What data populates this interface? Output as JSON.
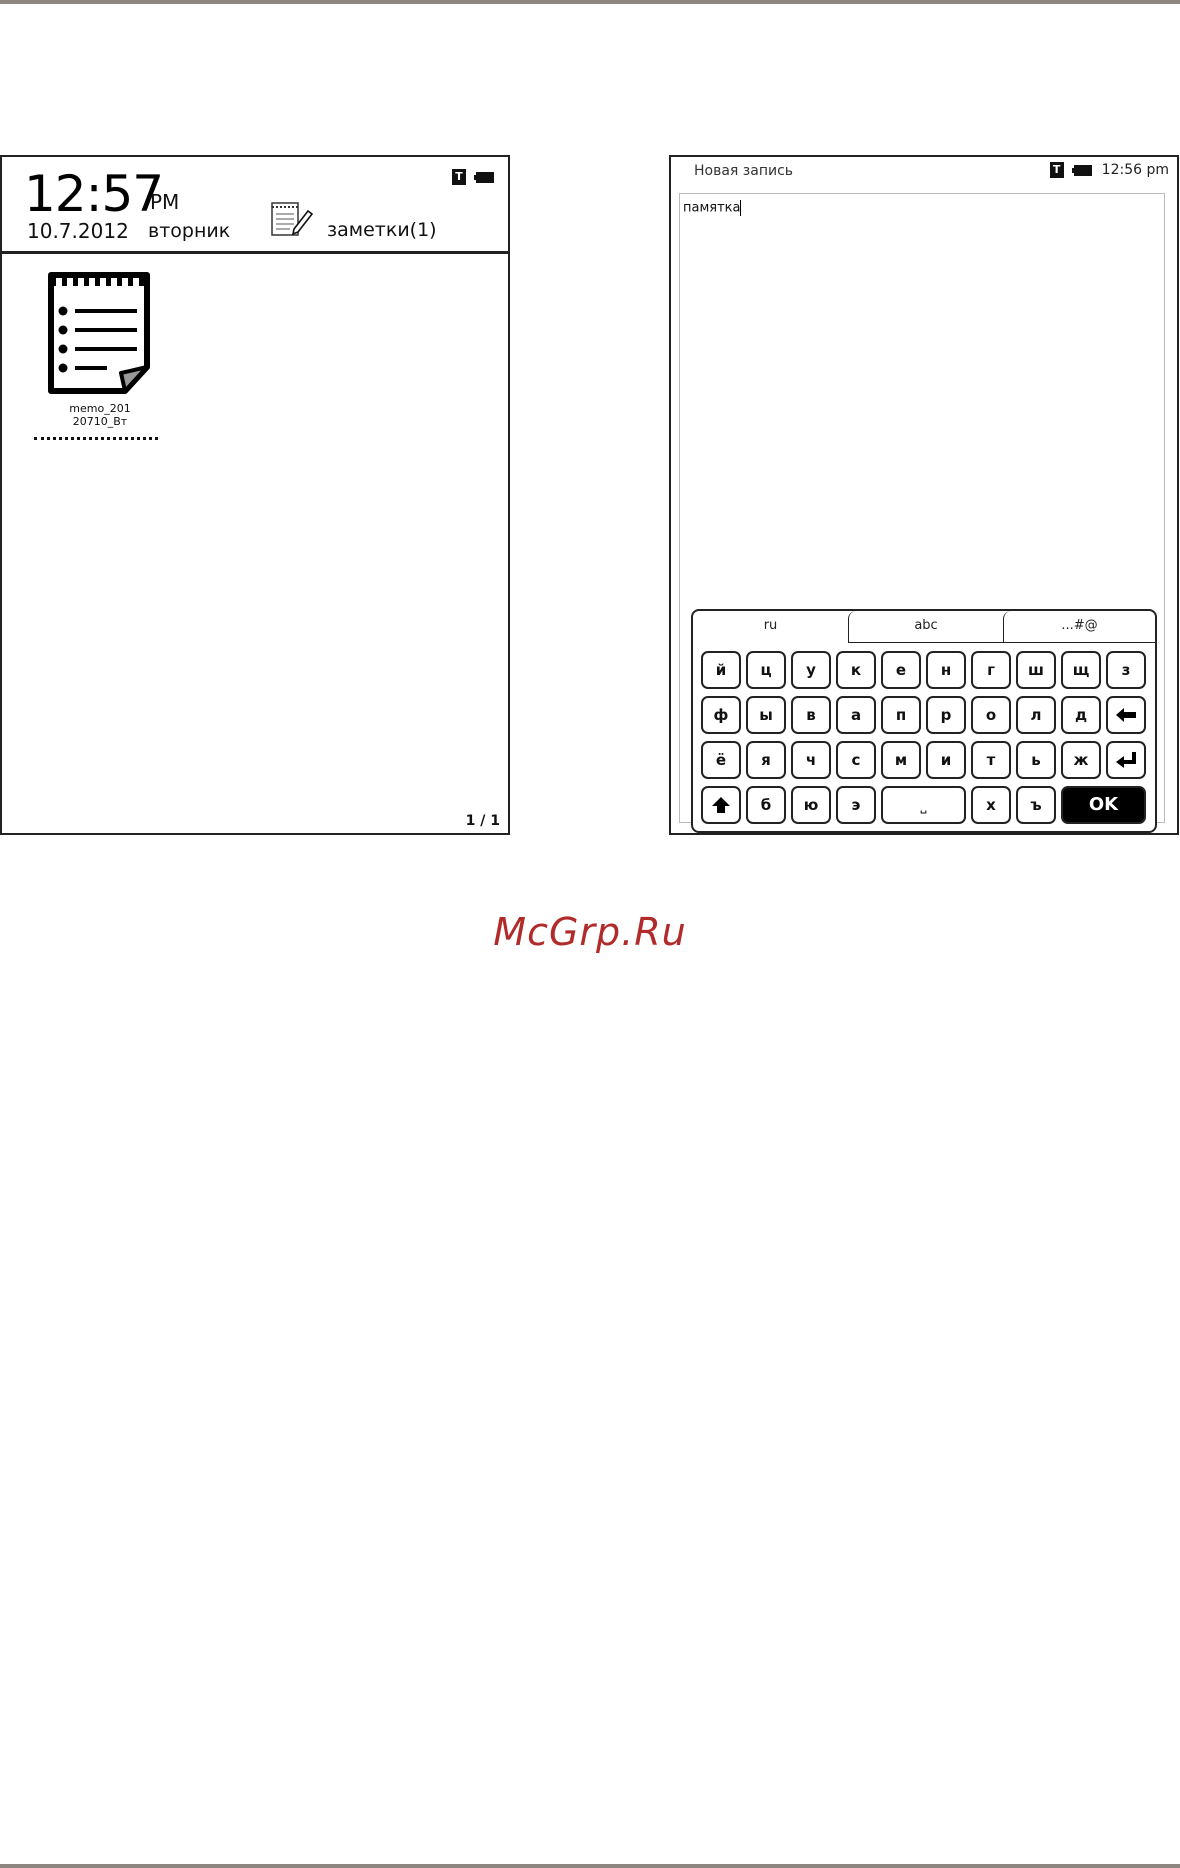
{
  "left_screen": {
    "clock": "12:57",
    "ampm": "PM",
    "date": "10.7.2012",
    "weekday": "вторник",
    "notes_label": "заметки(1)",
    "status_icon_t": "T",
    "memo_file": "memo_201\n20710_Вт",
    "page_indicator": "1 / 1"
  },
  "right_screen": {
    "title": "Новая запись",
    "status_icon_t": "T",
    "time": "12:56 pm",
    "editor_text": "памятка",
    "keyboard": {
      "tabs": [
        "ru",
        "abc",
        "...#@"
      ],
      "active_tab": "ru",
      "row1": [
        "й",
        "ц",
        "у",
        "к",
        "е",
        "н",
        "г",
        "ш",
        "щ",
        "з"
      ],
      "row2": [
        "ф",
        "ы",
        "в",
        "а",
        "п",
        "р",
        "о",
        "л",
        "д"
      ],
      "row3": [
        "ё",
        "я",
        "ч",
        "с",
        "м",
        "и",
        "т",
        "ь",
        "ж"
      ],
      "row4": [
        "б",
        "ю",
        "э"
      ],
      "row4b": [
        "х",
        "ъ"
      ],
      "space_symbol": "⎵",
      "ok_label": "OK",
      "icons": {
        "backspace": "arrow-left-icon",
        "enter": "enter-icon",
        "shift": "shift-icon"
      }
    }
  },
  "watermark": "McGrp.Ru"
}
